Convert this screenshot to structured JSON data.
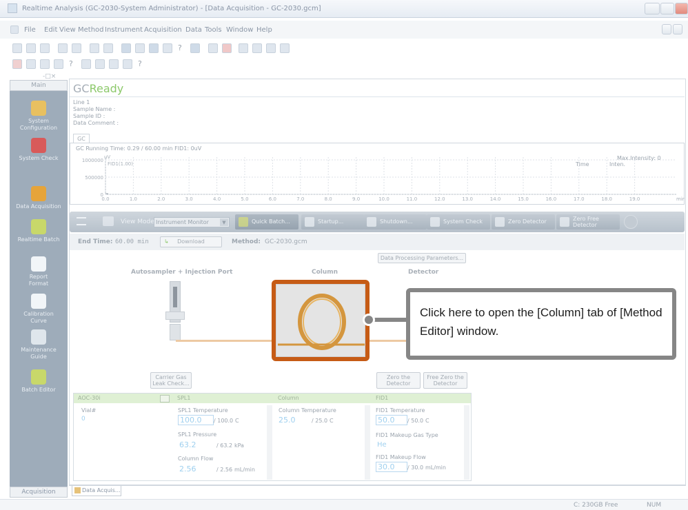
{
  "window": {
    "title": "Realtime Analysis (GC-2030-System Administrator) - [Data Acquisition - GC-2030.gcm]"
  },
  "menu": [
    "File",
    "Edit",
    "View",
    "Method",
    "Instrument",
    "Acquisition",
    "Data",
    "Tools",
    "Window",
    "Help"
  ],
  "sidebar": {
    "header": "Main",
    "items": [
      {
        "label": "System Configuration",
        "icon": "system-configuration-icon",
        "color": "#e8c060"
      },
      {
        "label": "System Check",
        "icon": "system-check-icon",
        "color": "#d85a5a"
      },
      {
        "label": "Data Acquisition",
        "icon": "flask-icon",
        "color": "#e6a43a"
      },
      {
        "label": "Realtime Batch",
        "icon": "batch-icon",
        "color": "#c8d86a"
      },
      {
        "label": "Report Format",
        "icon": "report-icon",
        "color": "#f1f5f8"
      },
      {
        "label": "Calibration Curve",
        "icon": "calibration-icon",
        "color": "#f1f5f8"
      },
      {
        "label": "Maintenance Guide",
        "icon": "maintenance-icon",
        "color": "#dfe6ec"
      },
      {
        "label": "Batch Editor",
        "icon": "batch-editor-icon",
        "color": "#c8d86a"
      }
    ],
    "footer": "Acquisition"
  },
  "status": {
    "prefix": "GC",
    "state": "Ready",
    "state_color": "#8dc96b"
  },
  "info": {
    "line": "Line 1",
    "sample_name": "Sample Name :",
    "sample_id": "Sample ID :",
    "data_comment": "Data Comment :"
  },
  "plot": {
    "tab": "GC",
    "header": "GC Running Time: 0.29 / 60.00 min FID1: 0uV",
    "trace": "FID1(1.00)",
    "yunit": "uV",
    "max_intensity": "Max.Intensity:    0",
    "time_col": "Time",
    "inten_col": "Inten.",
    "yticks": [
      "1000000",
      "500000",
      "0"
    ],
    "xticks": [
      "0.0",
      "1.0",
      "2.0",
      "3.0",
      "4.0",
      "5.0",
      "6.0",
      "7.0",
      "8.0",
      "9.0",
      "10.0",
      "11.0",
      "12.0",
      "13.0",
      "14.0",
      "15.0",
      "16.0",
      "17.0",
      "18.0",
      "19.0"
    ],
    "xunit": "min"
  },
  "toolbar": {
    "view_mode_label": "View Mode",
    "view_mode_value": "Instrument Monitor",
    "buttons": [
      "Quick Batch...",
      "Startup...",
      "Shutdown...",
      "System Check",
      "Zero Detector",
      "Zero Free Detector"
    ]
  },
  "method_row": {
    "end_time_label": "End Time:",
    "end_time_value": "60.00  min",
    "download": "Download",
    "method_label": "Method:",
    "method_value": "GC-2030.gcm"
  },
  "data_processing_button": "Data Processing Parameters...",
  "diagram": {
    "autosampler": "Autosampler + Injection Port",
    "column": "Column",
    "detector": "Detector"
  },
  "buttons_row": {
    "carrier": "Carrier Gas Leak Check...",
    "zero_det": "Zero the Detector",
    "free_zero": "Free Zero the Detector"
  },
  "panels": {
    "aoc": {
      "header": "AOC-30i",
      "vial_label": "Vial#",
      "vial_value": "0"
    },
    "spl": {
      "header": "SPL1",
      "temp_label": "SPL1 Temperature",
      "temp_value": "100.0",
      "temp_set": "/ 100.0",
      "temp_unit": "C",
      "pres_label": "SPL1 Pressure",
      "pres_value": "63.2",
      "pres_set": "/ 63.2",
      "pres_unit": "kPa",
      "flow_label": "Column Flow",
      "flow_value": "2.56",
      "flow_set": "/ 2.56",
      "flow_unit": "mL/min"
    },
    "column": {
      "header": "Column",
      "temp_label": "Column Temperature",
      "temp_value": "25.0",
      "temp_set": "/ 25.0",
      "temp_unit": "C"
    },
    "fid": {
      "header": "FID1",
      "temp_label": "FID1 Temperature",
      "temp_value": "50.0",
      "temp_set": "/ 50.0",
      "temp_unit": "C",
      "gas_label": "FID1 Makeup Gas Type",
      "gas_value": "He",
      "flow_label": "FID1 Makeup Flow",
      "flow_value": "30.0",
      "flow_set": "/ 30.0",
      "flow_unit": "mL/min"
    }
  },
  "doc_tab": "Data Acquis...",
  "statusbar": {
    "disk": "C:  230GB Free",
    "num": "NUM"
  },
  "callout": {
    "text": "Click here to open the [Column] tab of [Method Editor] window.",
    "border_color": "#868686",
    "highlight_color": "#c65b15",
    "column_color": "#d4963e"
  }
}
